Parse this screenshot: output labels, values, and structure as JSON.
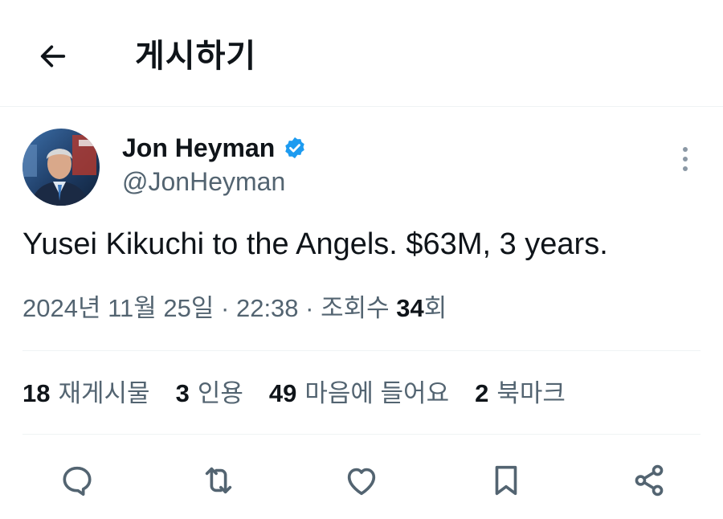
{
  "header": {
    "title": "게시하기",
    "back_icon": "arrow-left-icon"
  },
  "author": {
    "display_name": "Jon Heyman",
    "handle": "@JonHeyman",
    "verified_icon": "verified-badge-icon",
    "verified_color": "#1d9bf0"
  },
  "tweet": {
    "text": "Yusei Kikuchi to the Angels. $63M, 3 years.",
    "timestamp": "2024년 11월 25일 · 22:38 · 조회수 ",
    "views_count": "34",
    "views_suffix": "회"
  },
  "stats": [
    {
      "count": "18",
      "label": "재게시물"
    },
    {
      "count": "3",
      "label": "인용"
    },
    {
      "count": "49",
      "label": "마음에 들어요"
    },
    {
      "count": "2",
      "label": "북마크"
    }
  ],
  "actions": [
    "reply-icon",
    "repost-icon",
    "like-icon",
    "bookmark-icon",
    "share-icon"
  ],
  "colors": {
    "text": "#0f1419",
    "secondary_text": "#536471",
    "icon": "#536471",
    "divider": "#eff3f4"
  }
}
